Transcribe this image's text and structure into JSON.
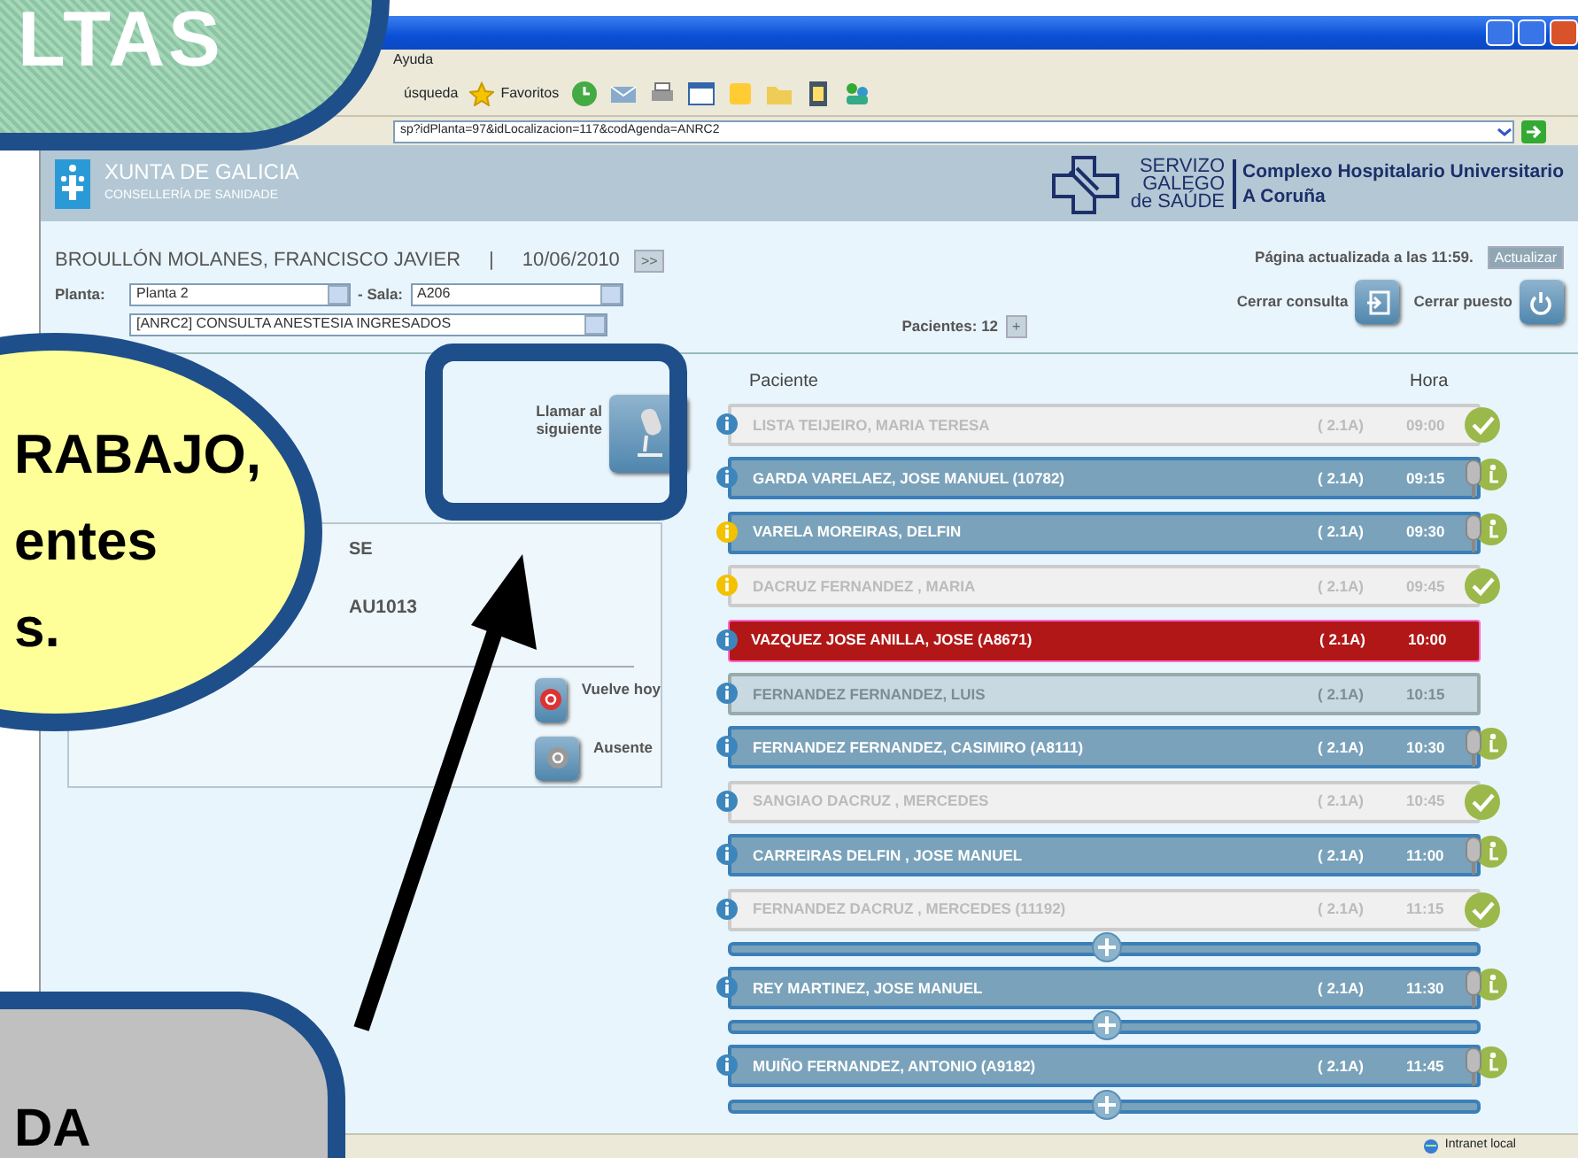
{
  "browser": {
    "menu": [
      "Ayuda"
    ],
    "search_label": "úsqueda",
    "favorites_label": "Favoritos",
    "address": "sp?idPlanta=97&idLocalizacion=117&codAgenda=ANRC2",
    "status": "Intranet local"
  },
  "header": {
    "org": "XUNTA DE GALICIA",
    "dept": "CONSELLERÍA DE SANIDADE",
    "service": [
      "SERVIZO",
      "GALEGO",
      "de SAÚDE"
    ],
    "hospital": [
      "Complexo Hospitalario Universitario",
      "A Coruña"
    ]
  },
  "doctor": "BROULLÓN MOLANES, FRANCISCO JAVIER",
  "separator": "|",
  "date": "10/06/2010",
  "next_button": ">>",
  "planta": {
    "label": "Planta:",
    "value": "Planta 2"
  },
  "sala": {
    "label": "- Sala:",
    "value": "A206"
  },
  "agenda": {
    "value": "[ANRC2] CONSULTA ANESTESIA INGRESADOS"
  },
  "updated": "Página actualizada a las 11:59.",
  "refresh_button": "Actualizar",
  "patients_count": "Pacientes: 12",
  "count_button": "+",
  "close_consult": "Cerrar consulta",
  "close_post": "Cerrar puesto",
  "call_next": "Llamar al siguiente",
  "panel": {
    "title": "SE",
    "code": "AU1013",
    "actions": [
      {
        "label": "Vuelve hoy",
        "kind": "return"
      },
      {
        "label": "Ausente",
        "kind": "absent"
      }
    ]
  },
  "list": {
    "columns": [
      "Paciente",
      "Hora"
    ],
    "rows": [
      {
        "kind": "attended",
        "name": "LISTA TEIJEIRO, MARIA TERESA",
        "room": "( 2.1A)",
        "time": "09:00",
        "color": "#3d86bd"
      },
      {
        "kind": "waiting",
        "name": "GARDA VARELAEZ, JOSE MANUEL (10782)",
        "room": "( 2.1A)",
        "time": "09:15",
        "color": "#3d86bd"
      },
      {
        "kind": "waiting",
        "name": "VARELA MOREIRAS, DELFIN",
        "room": "( 2.1A)",
        "time": "09:30",
        "color": "#f2c200"
      },
      {
        "kind": "attended",
        "name": "DACRUZ FERNANDEZ , MARIA",
        "room": "( 2.1A)",
        "time": "09:45",
        "color": "#f2c200"
      },
      {
        "kind": "called",
        "name": "VAZQUEZ JOSE ANILLA, JOSE (A8671)",
        "room": "( 2.1A)",
        "time": "10:00",
        "color": "#3d86bd"
      },
      {
        "kind": "absent",
        "name": "FERNANDEZ FERNANDEZ, LUIS",
        "room": "( 2.1A)",
        "time": "10:15",
        "color": "#3d86bd"
      },
      {
        "kind": "waiting",
        "name": "FERNANDEZ  FERNANDEZ, CASIMIRO (A8111)",
        "room": "( 2.1A)",
        "time": "10:30",
        "color": "#3d86bd"
      },
      {
        "kind": "attended",
        "name": "SANGIAO DACRUZ , MERCEDES",
        "room": "( 2.1A)",
        "time": "10:45",
        "color": "#3d86bd"
      },
      {
        "kind": "waiting",
        "name": "CARREIRAS DELFIN , JOSE MANUEL",
        "room": "( 2.1A)",
        "time": "11:00",
        "color": "#3d86bd"
      },
      {
        "kind": "attended",
        "name": "FERNANDEZ DACRUZ , MERCEDES (11192)",
        "room": "( 2.1A)",
        "time": "11:15",
        "color": "#3d86bd"
      },
      {
        "kind": "slot"
      },
      {
        "kind": "waiting",
        "name": "REY MARTINEZ, JOSE MANUEL",
        "room": "( 2.1A)",
        "time": "11:30",
        "color": "#3d86bd"
      },
      {
        "kind": "slot"
      },
      {
        "kind": "waiting",
        "name": "MUIÑO FERNANDEZ, ANTONIO (A9182)",
        "room": "( 2.1A)",
        "time": "11:45",
        "color": "#3d86bd"
      },
      {
        "kind": "slot"
      }
    ]
  },
  "callouts": [
    {
      "kind": "top",
      "lines": [
        "LTAS"
      ]
    },
    {
      "kind": "left",
      "lines": [
        "RABAJO,",
        "entes",
        "s."
      ]
    },
    {
      "kind": "bottom",
      "lines": [
        "DA"
      ]
    }
  ]
}
